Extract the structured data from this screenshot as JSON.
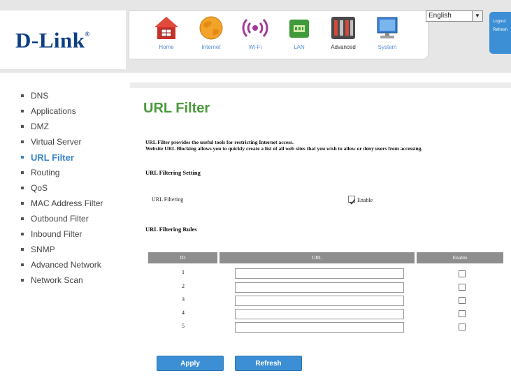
{
  "brand": {
    "logo": "D-Link",
    "mark": "®"
  },
  "nav": [
    {
      "label": "Home",
      "icon": "home-icon"
    },
    {
      "label": "Internet",
      "icon": "globe-icon"
    },
    {
      "label": "Wi-Fi",
      "icon": "wifi-icon"
    },
    {
      "label": "LAN",
      "icon": "lan-icon"
    },
    {
      "label": "Advanced",
      "icon": "advanced-icon",
      "active": true
    },
    {
      "label": "System",
      "icon": "system-icon"
    }
  ],
  "language": {
    "selected": "English"
  },
  "side_tab": {
    "logout": "Logout",
    "refresh": "Refresh"
  },
  "sidebar": [
    "DNS",
    "Applications",
    "DMZ",
    "Virtual Server",
    "URL Filter",
    "Routing",
    "QoS",
    "MAC Address Filter",
    "Outbound Filter",
    "Inbound Filter",
    "SNMP",
    "Advanced Network",
    "Network Scan"
  ],
  "sidebar_active": "URL Filter",
  "page": {
    "title": "URL Filter",
    "desc1": "URL Filter provides the useful tools for restricting Internet access.",
    "desc2": "Website URL Blocking allows you to quickly create a list of all web sites that you wish to allow or deny users from accessing.",
    "setting_heading": "URL Filtering Setting",
    "filtering_label": "URL Filtering",
    "enable_label": "Enable",
    "filtering_enabled": true,
    "rules_heading": "URL Filtering Rules"
  },
  "table": {
    "headers": [
      "ID",
      "URL",
      "Enable"
    ],
    "rows": [
      {
        "id": "1",
        "url": "",
        "enabled": false
      },
      {
        "id": "2",
        "url": "",
        "enabled": false
      },
      {
        "id": "3",
        "url": "",
        "enabled": false
      },
      {
        "id": "4",
        "url": "",
        "enabled": false
      },
      {
        "id": "5",
        "url": "",
        "enabled": false
      }
    ]
  },
  "buttons": {
    "apply": "Apply",
    "refresh": "Refresh"
  },
  "colors": {
    "accent": "#3c8fd4",
    "title": "#4a9a3a",
    "header_gray": "#8e8e8e",
    "logo_blue": "#0d3f86"
  }
}
